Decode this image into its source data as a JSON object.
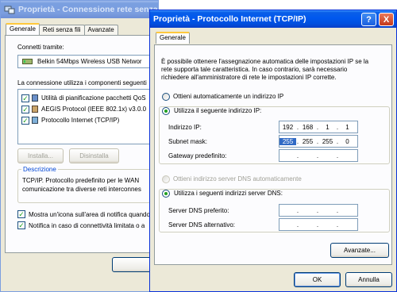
{
  "back_window": {
    "title": "Proprietà - Connessione rete senza fili ...",
    "tabs": [
      "Generale",
      "Reti senza fili",
      "Avanzate"
    ],
    "connect_label": "Connetti tramite:",
    "adapter": "Belkin 54Mbps Wireless USB Networ",
    "components_label": "La connessione utilizza i componenti seguenti",
    "components": [
      {
        "label": "Utilità di pianificazione pacchetti QoS",
        "checked": true
      },
      {
        "label": "AEGIS Protocol (IEEE 802.1x) v3.0.0",
        "checked": true
      },
      {
        "label": "Protocollo Internet (TCP/IP)",
        "checked": true
      }
    ],
    "install_button": "Installa...",
    "uninstall_button": "Disinstalla",
    "description_title": "Descrizione",
    "description_line1": "TCP/IP. Protocollo predefinito per le WAN",
    "description_line2": "comunicazione tra diverse reti interconnes",
    "check_notify_icon": "Mostra un'icona sull'area di notifica quando",
    "check_notify_limited": "Notifica in caso di connettività limitata o a"
  },
  "front_window": {
    "title": "Proprietà - Protocollo Internet (TCP/IP)",
    "help_button": "?",
    "close_button": "X",
    "tab": "Generale",
    "intro_line1": "È possibile ottenere l'assegnazione automatica delle impostazioni IP se la",
    "intro_line2": "rete supporta tale caratteristica. In caso contrario, sarà necessario",
    "intro_line3": "richiedere all'amministratore di rete le impostazioni IP corrette.",
    "radio_auto_ip": "Ottieni automaticamente un indirizzo IP",
    "radio_manual_ip": "Utilizza il seguente indirizzo IP:",
    "ip_label": "Indirizzo IP:",
    "ip_value": [
      "192",
      "168",
      "1",
      "1"
    ],
    "mask_label": "Subnet mask:",
    "mask_value": [
      "255",
      "255",
      "255",
      "0"
    ],
    "gateway_label": "Gateway predefinito:",
    "gateway_value": [
      "",
      "",
      "",
      ""
    ],
    "radio_auto_dns": "Ottieni indirizzo server DNS automaticamente",
    "radio_manual_dns": "Utilizza i seguenti indirizzi server DNS:",
    "dns_pref_label": "Server DNS preferito:",
    "dns_alt_label": "Server DNS alternativo:",
    "advanced_button": "Avanzate...",
    "ok_button": "OK",
    "cancel_button": "Annulla",
    "selected_ip_mode": "manual",
    "selected_dns_mode": "manual"
  },
  "colors": {
    "title_active": "#0058ee",
    "title_inactive": "#7b9ee0",
    "dialog_bg": "#ece9d8",
    "selection": "#316ac5",
    "radio_dot": "#21a121"
  }
}
